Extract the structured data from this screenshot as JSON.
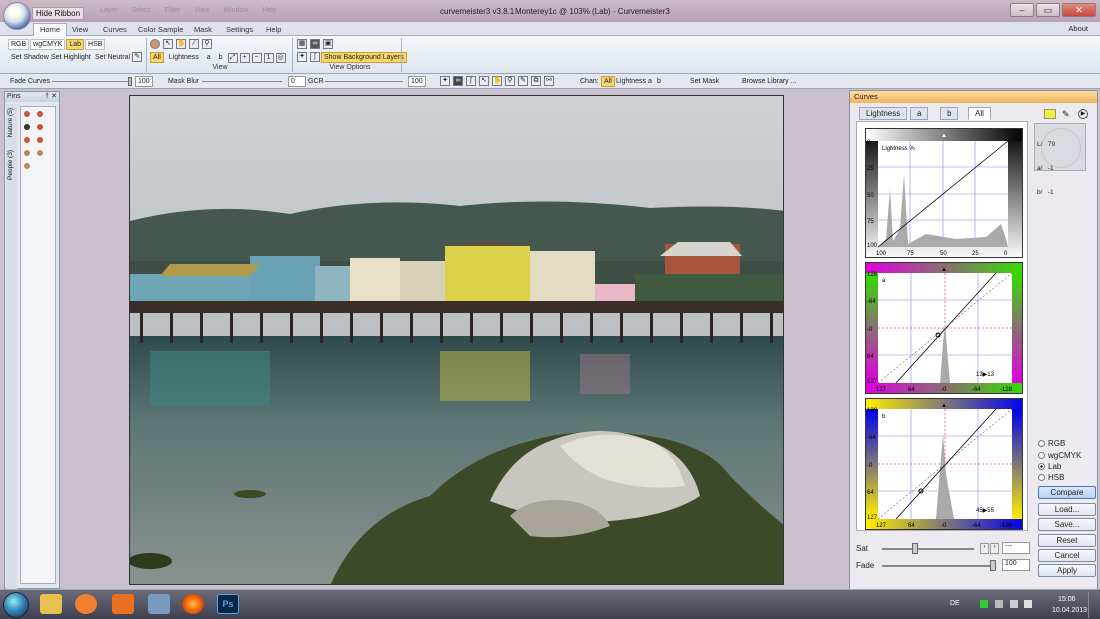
{
  "window": {
    "hide_ribbon": "Hide Ribbon",
    "app_title": "curvemeister3 v3.8.1",
    "doc_title": "Monterey1c @ 103% (Lab) - Curvemeister3",
    "ghost_menu": [
      "Layer",
      "Select",
      "Filter",
      "View",
      "Window",
      "Help"
    ]
  },
  "ribbon_tabs": [
    "Home",
    "View",
    "Curves",
    "Color Sample",
    "Mask",
    "Settings",
    "Help"
  ],
  "about": "About",
  "ribbon": {
    "modes": [
      "RGB",
      "wgCMYK",
      "Lab",
      "HSB"
    ],
    "mode_active": "Lab",
    "set_shadow": "Set Shadow",
    "set_highlight": "Set Highlight",
    "set_neutral": "Set Neutral",
    "channels": [
      "All",
      "Lightness",
      "a",
      "b"
    ],
    "view_label": "View",
    "show_bg_layers": "Show Background Layers",
    "view_options_label": "View Options"
  },
  "toolbar2": {
    "fade_curves": "Fade Curves",
    "fade_value": "100",
    "mask_blur": "Mask Blur",
    "mask_blur_value": "0",
    "gcr": "GCR",
    "gcr_value": "100",
    "chan": "Chan:",
    "chan_all": "All",
    "chan_lightness": "Lightness",
    "chan_a": "a",
    "chan_b": "b",
    "set_mask": "Set Mask",
    "browse_library": "Browse Library ..."
  },
  "pins": {
    "title": "Pins",
    "pin_btn": "†",
    "close": "✕",
    "tab_nature": "Nature (5)",
    "tab_people": "People (3)"
  },
  "curves": {
    "title": "Curves",
    "tabs": [
      "Lightness",
      "a",
      "b",
      "All"
    ],
    "active_tab": "All",
    "readout": [
      "L/   79",
      "a/   -1",
      "b/   -1"
    ],
    "lightness": {
      "label": "Lightness %",
      "y_ticks": [
        "0",
        "25",
        "50",
        "75",
        "100"
      ],
      "x_ticks": [
        "100",
        "75",
        "50",
        "25",
        "0"
      ]
    },
    "a": {
      "label": "a",
      "y_ticks": [
        "128",
        "-64",
        "-0",
        "64",
        "127"
      ],
      "x_ticks": [
        "127",
        "64",
        "-0",
        "-64",
        "-128"
      ],
      "point": "13▶13"
    },
    "b": {
      "label": "b",
      "y_ticks": [
        "128",
        "-64",
        "-0",
        "64",
        "127"
      ],
      "x_ticks": [
        "127",
        "64",
        "-0",
        "-64",
        "-128"
      ],
      "point": "45▶55"
    },
    "modes": [
      "RGB",
      "wgCMYK",
      "Lab",
      "HSB"
    ],
    "mode_selected": "Lab",
    "compare": "Compare",
    "load": "Load...",
    "save": "Save...",
    "reset": "Reset",
    "cancel": "Cancel",
    "apply": "Apply",
    "sat_label": "Sat",
    "sat_value": "---",
    "fade_label": "Fade",
    "fade_value": "100"
  },
  "taskbar": {
    "lang": "DE",
    "time": "15:06",
    "date": "10.04.2013",
    "ps": "Ps"
  },
  "colors": {
    "ribbon_active": "#f9d66c",
    "curves_header": "#f0b560",
    "a_plus": "#e000e0",
    "a_minus": "#33dd00",
    "b_plus": "#ffee00",
    "b_minus": "#0000ee"
  }
}
